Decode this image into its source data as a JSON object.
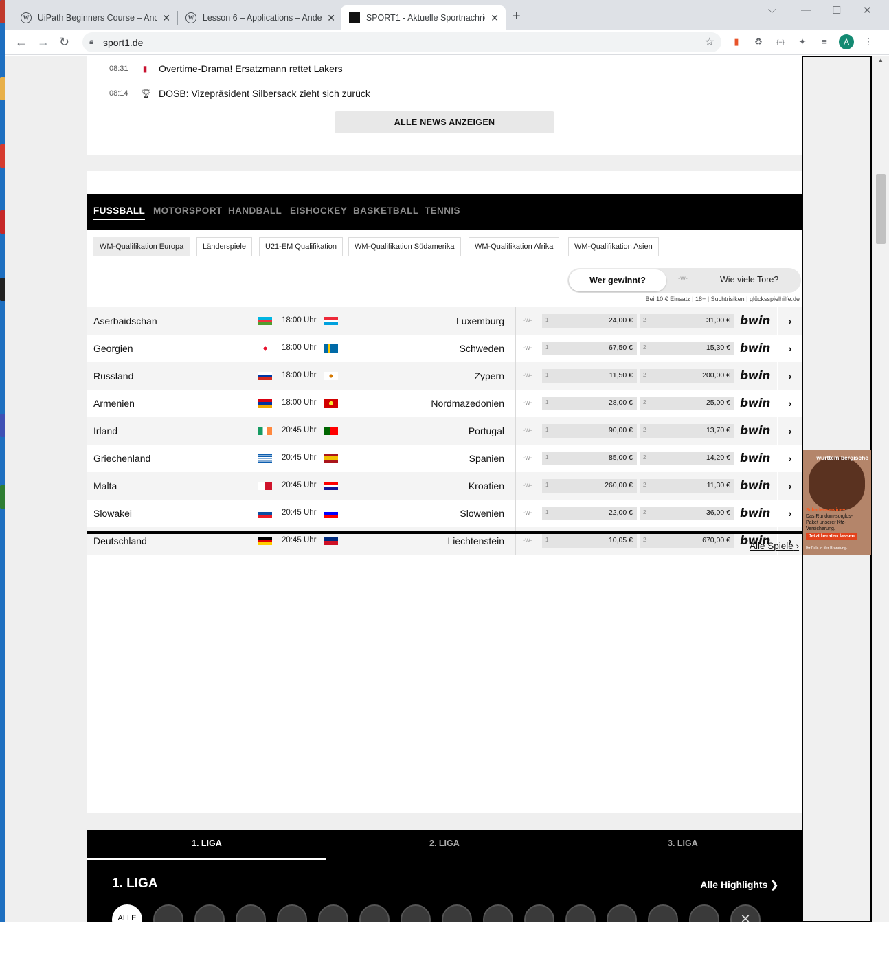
{
  "browser": {
    "tabs": [
      {
        "title": "UiPath Beginners Course – Anders",
        "icon": "wordpress-icon"
      },
      {
        "title": "Lesson 6 – Applications – Anders",
        "icon": "wordpress-icon"
      },
      {
        "title": "SPORT1 - Aktuelle Sportnachrichten",
        "icon": "sport1-icon"
      }
    ],
    "new_tab": "+",
    "url": "sport1.de",
    "profile_initial": "A"
  },
  "news": {
    "items": [
      {
        "time": "08:31",
        "icon": "nba-icon",
        "text": "Overtime-Drama! Ersatzmann rettet Lakers"
      },
      {
        "time": "08:14",
        "icon": "trophy-icon",
        "text": "DOSB: Vizepräsident Silbersack zieht sich zurück"
      }
    ],
    "all_button": "ALLE NEWS ANZEIGEN"
  },
  "sports": {
    "tabs": [
      "FUSSBALL",
      "MOTORSPORT",
      "HANDBALL",
      "EISHOCKEY",
      "BASKETBALL",
      "TENNIS"
    ],
    "competitions": [
      "WM-Qualifikation Europa",
      "Länderspiele",
      "U21-EM Qualifikation",
      "WM-Qualifikation Südamerika",
      "WM-Qualifikation Afrika",
      "WM-Qualifikation Asien"
    ],
    "toggle": {
      "active": "Wer gewinnt?",
      "separator": "-w-",
      "inactive": "Wie viele Tore?"
    },
    "disclaimer": "Bei 10 € Einsatz | 18+ | Suchtrisiken | glücksspielhilfe.de",
    "bookmaker": "bwin",
    "odd_label_home": "1",
    "odd_label_away": "2",
    "matches": [
      {
        "home": "Aserbaidschan",
        "time": "18:00 Uhr",
        "away": "Luxemburg",
        "draw": "-w-",
        "odd1": "24,00 €",
        "odd2": "31,00 €"
      },
      {
        "home": "Georgien",
        "time": "18:00 Uhr",
        "away": "Schweden",
        "draw": "-w-",
        "odd1": "67,50 €",
        "odd2": "15,30 €"
      },
      {
        "home": "Russland",
        "time": "18:00 Uhr",
        "away": "Zypern",
        "draw": "-w-",
        "odd1": "11,50 €",
        "odd2": "200,00 €"
      },
      {
        "home": "Armenien",
        "time": "18:00 Uhr",
        "away": "Nordmazedonien",
        "draw": "-w-",
        "odd1": "28,00 €",
        "odd2": "25,00 €"
      },
      {
        "home": "Irland",
        "time": "20:45 Uhr",
        "away": "Portugal",
        "draw": "-w-",
        "odd1": "90,00 €",
        "odd2": "13,70 €"
      },
      {
        "home": "Griechenland",
        "time": "20:45 Uhr",
        "away": "Spanien",
        "draw": "-w-",
        "odd1": "85,00 €",
        "odd2": "14,20 €"
      },
      {
        "home": "Malta",
        "time": "20:45 Uhr",
        "away": "Kroatien",
        "draw": "-w-",
        "odd1": "260,00 €",
        "odd2": "11,30 €"
      },
      {
        "home": "Slowakei",
        "time": "20:45 Uhr",
        "away": "Slowenien",
        "draw": "-w-",
        "odd1": "22,00 €",
        "odd2": "36,00 €"
      },
      {
        "home": "Deutschland",
        "time": "20:45 Uhr",
        "away": "Liechtenstein",
        "draw": "-w-",
        "odd1": "10,05 €",
        "odd2": "670,00 €"
      }
    ],
    "all_games": "Alle Spiele"
  },
  "liga": {
    "tabs": [
      "1. LIGA",
      "2. LIGA",
      "3. LIGA"
    ],
    "title": "1. LIGA",
    "highlights": "Alle Highlights",
    "all_chip": "ALLE"
  },
  "ad": {
    "brand": "württem bergische",
    "headline": "Schadenservice+",
    "body": "Das Rundum-sorglos-Paket unserer Kfz-Versicherung.",
    "cta": "Jetzt beraten lassen",
    "footer": "Ihr Fels in der Brandung."
  },
  "colors": {
    "brand_black": "#000000",
    "chip_active": "#ebebeb",
    "odds_bg": "#e3e3e3"
  }
}
